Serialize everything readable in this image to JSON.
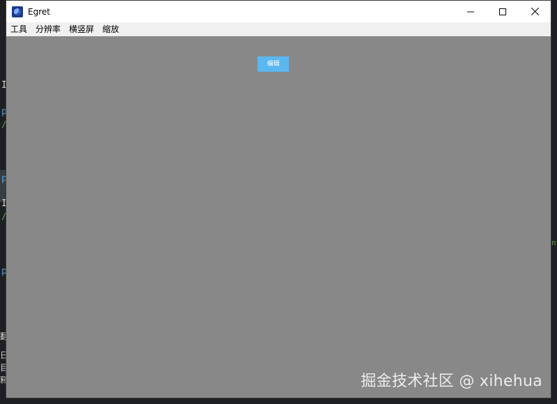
{
  "window": {
    "title": "Egret",
    "controls": {
      "minimize_icon": "minimize-icon",
      "maximize_icon": "maximize-icon",
      "close_icon": "close-icon"
    }
  },
  "menubar": {
    "items": [
      {
        "label": "工具"
      },
      {
        "label": "分辨率"
      },
      {
        "label": "横竖屏"
      },
      {
        "label": "缩放"
      }
    ]
  },
  "canvas": {
    "background": "#888888",
    "edit_button": {
      "label": "编辑",
      "color": "#5bb7f0"
    }
  },
  "watermark": {
    "text": "掘金技术社区 @ xihehua"
  },
  "background_fragments": [
    "I",
    "p",
    "/",
    "p",
    "I",
    "/",
    "p",
    "nt",
    "翻",
    "日",
    "目",
    "释"
  ]
}
